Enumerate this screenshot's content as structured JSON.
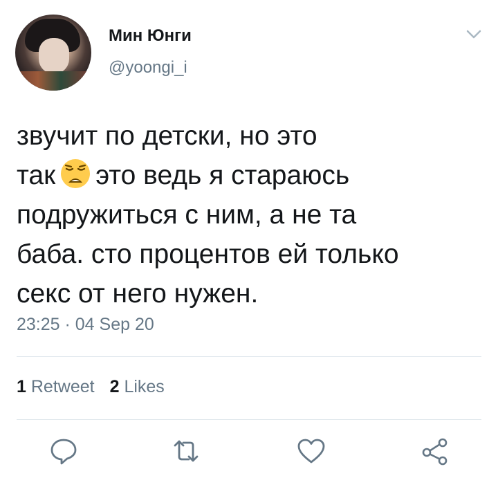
{
  "user": {
    "display_name": "Мин Юнги",
    "handle": "@yoongi_i"
  },
  "tweet": {
    "lines": [
      "звучит по детски, но это",
      "так",
      "это ведь я стараюсь",
      "подружиться с ним, а не та",
      "баба. сто процентов ей только",
      "секс от него нужен."
    ],
    "emoji": "weary-face",
    "timestamp": "23:25 · 04 Sep 20"
  },
  "stats": {
    "retweets_count": "1",
    "retweets_label": "Retweet",
    "likes_count": "2",
    "likes_label": "Likes"
  },
  "icons": {
    "menu": "chevron-down-icon",
    "reply": "reply-icon",
    "retweet": "retweet-icon",
    "like": "heart-icon",
    "share": "share-icon"
  },
  "colors": {
    "text": "#14171a",
    "secondary": "#657786",
    "divider": "#e1e8ed",
    "icon": "#657786"
  }
}
